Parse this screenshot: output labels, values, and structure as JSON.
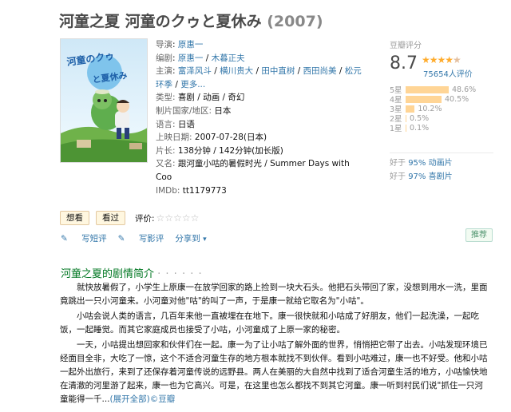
{
  "title": {
    "name": "河童之夏 河童のクゥと夏休み",
    "year": "(2007)"
  },
  "info": {
    "director_label": "导演",
    "director": "原惠一",
    "writer_label": "编剧",
    "writer1": "原惠一",
    "writer2": "木暮正夫",
    "cast_label": "主演",
    "cast1": "富泽风斗",
    "cast2": "横川贵大",
    "cast3": "田中直树",
    "cast4": "西田尚美",
    "cast5": "松元环季",
    "more": "更多...",
    "genre_label": "类型:",
    "genre": "喜剧 / 动画 / 奇幻",
    "country_label": "制片国家/地区:",
    "country": "日本",
    "language_label": "语言:",
    "language": "日语",
    "release_label": "上映日期:",
    "release": "2007-07-28(日本)",
    "runtime_label": "片长:",
    "runtime": "138分钟 / 142分钟(加长版)",
    "aka_label": "又名:",
    "aka": "跟河童小咕的暑假时光 / Summer Days with Coo",
    "imdb_label": "IMDb:",
    "imdb": "tt1179773"
  },
  "rating": {
    "header": "豆瓣评分",
    "score": "8.7",
    "stars": 4.5,
    "votes": "75654人评价",
    "star_color": "#ffac2d",
    "bars": [
      {
        "label": "5星",
        "pct": "48.6%",
        "value": 48.6
      },
      {
        "label": "4星",
        "pct": "40.5%",
        "value": 40.5
      },
      {
        "label": "3星",
        "pct": "10.2%",
        "value": 10.2
      },
      {
        "label": "2星",
        "pct": "0.5%",
        "value": 0.5
      },
      {
        "label": "1星",
        "pct": "0.1%",
        "value": 0.1
      }
    ],
    "better1_prefix": "好于",
    "better1_pct": "95%",
    "better1_cat": "动画片",
    "better2_prefix": "好于",
    "better2_pct": "97%",
    "better2_cat": "喜剧片"
  },
  "actions": {
    "want": "想看",
    "seen": "看过",
    "rate_label": "评价:",
    "rate_stars": "☆☆☆☆☆"
  },
  "tools": {
    "short_review": "写短评",
    "review": "写影评",
    "share": "分享到",
    "recommend": "推荐"
  },
  "intro": {
    "heading": "河童之夏的剧情简介",
    "dots": "· · · · · ·",
    "p1": "就快放暑假了，小学生上原康一在放学回家的路上捡到一块大石头。他把石头带回了家，没想到用水一洗，里面竟跳出一只小河童来。小河童对他\"咕\"的叫了一声，于是康一就给它取名为\"小咕\"。",
    "p2": "小咕会说人类的语言，几百年来他一直被埋在在地下。康一很快就和小咕成了好朋友，他们一起洗澡，一起吃饭，一起睡觉。而其它家庭成员也接受了小咕，小河童成了上原一家的秘密。",
    "p3": "一天，小咕提出想回家和伙伴们在一起。康一为了让小咕了解外面的世界，悄悄把它带了出去。小咕发现环境已经面目全非，大吃了一惊，这个不适合河童生存的地方根本就找不到伙伴。看到小咕难过，康一也不好受。他和小咕一起外出旅行，来到了还保存着河童传说的远野县。两人在美丽的大自然中找到了适合河童生活的地方，小咕愉快地在清澈的河里游了起来，康一也为它高兴。可是，在这里也怎么都找不到其它河童。康一听到村民们说\"抓住一只河童能得一千...",
    "expand": "(展开全部)",
    "copyright": "©豆瓣"
  },
  "poster": {
    "logo_text": "河童のクゥと夏休み"
  }
}
